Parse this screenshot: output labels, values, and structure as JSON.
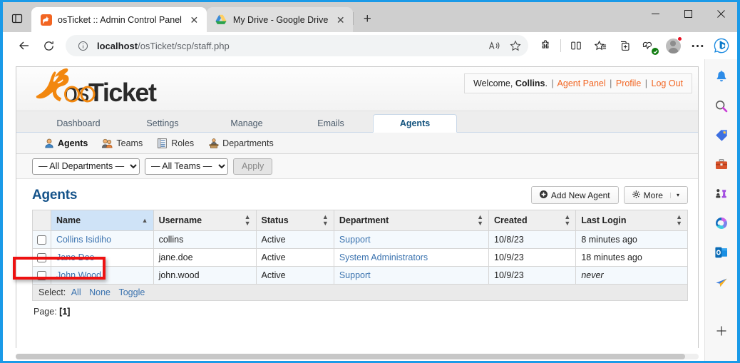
{
  "browser": {
    "tab_search_icon": "tab-search-icon",
    "tabs": [
      {
        "title": "osTicket :: Admin Control Panel",
        "favicon": "osticket-favicon",
        "close": "✕",
        "active": true
      },
      {
        "title": "My Drive - Google Drive",
        "favicon": "google-drive-favicon",
        "close": "✕",
        "active": false
      }
    ],
    "new_tab_label": "+",
    "window_controls": {
      "minimize": "—",
      "maximize": "☐",
      "close": "✕"
    },
    "toolbar": {
      "back_icon": "back-arrow-icon",
      "refresh_icon": "refresh-icon",
      "info_icon": "site-info-icon",
      "url_prefix": "localhost",
      "url_suffix": "/osTicket/scp/staff.php",
      "read_aloud_icon": "read-aloud-icon",
      "favorite_icon": "favorite-star-icon",
      "extensions_icon": "extensions-puzzle-icon",
      "split_screen_icon": "split-screen-icon",
      "collections_icon": "collections-icon",
      "browser_essentials_icon": "add-tab-to-collection-icon",
      "performance_icon": "browser-essentials-icon",
      "profile_icon": "profile-avatar-icon",
      "settings_icon": "settings-more-icon",
      "copilot_icon": "bing-copilot-icon"
    },
    "sidebar_icons": [
      "notifications-bell-icon",
      "search-icon",
      "shopping-tag-icon",
      "tools-briefcase-icon",
      "games-chess-icon",
      "microsoft-365-icon",
      "outlook-icon",
      "send-plane-icon",
      "add-sidebar-icon"
    ]
  },
  "osticket": {
    "logo_text": "osTicket",
    "welcome": {
      "prefix": "Welcome,",
      "user": "Collins",
      "period": ".",
      "links": [
        "Agent Panel",
        "Profile",
        "Log Out"
      ]
    },
    "main_tabs": [
      {
        "label": "Dashboard",
        "active": false
      },
      {
        "label": "Settings",
        "active": false
      },
      {
        "label": "Manage",
        "active": false
      },
      {
        "label": "Emails",
        "active": false
      },
      {
        "label": "Agents",
        "active": true
      }
    ],
    "sub_nav": [
      {
        "label": "Agents",
        "icon": "agent-person-icon",
        "active": true
      },
      {
        "label": "Teams",
        "icon": "teams-people-icon",
        "active": false
      },
      {
        "label": "Roles",
        "icon": "roles-list-icon",
        "active": false
      },
      {
        "label": "Departments",
        "icon": "departments-desk-icon",
        "active": false
      }
    ],
    "filters": {
      "department_value": "— All Departments —",
      "department_options": [
        "— All Departments —"
      ],
      "team_value": "— All Teams —",
      "team_options": [
        "— All Teams —"
      ],
      "apply_label": "Apply"
    },
    "page_title": "Agents",
    "buttons": {
      "add_new_agent": "Add New Agent",
      "add_icon": "plus-circle-icon",
      "more": "More",
      "more_icon": "gear-icon",
      "more_caret": "▾"
    },
    "table": {
      "columns": [
        {
          "label": "Name",
          "sorted": true,
          "sort_dir": "asc"
        },
        {
          "label": "Username",
          "sorted": false
        },
        {
          "label": "Status",
          "sorted": false
        },
        {
          "label": "Department",
          "sorted": false
        },
        {
          "label": "Created",
          "sorted": false
        },
        {
          "label": "Last Login",
          "sorted": false
        }
      ],
      "rows": [
        {
          "name": "Collins Isidiho",
          "username": "collins",
          "status": "Active",
          "department": "Support",
          "created": "10/8/23",
          "last_login": "8 minutes ago",
          "never": false,
          "highlighted": false
        },
        {
          "name": "Jane Doe",
          "username": "jane.doe",
          "status": "Active",
          "department": "System Administrators",
          "created": "10/9/23",
          "last_login": "18 minutes ago",
          "never": false,
          "highlighted": true
        },
        {
          "name": "John Wood",
          "username": "john.wood",
          "status": "Active",
          "department": "Support",
          "created": "10/9/23",
          "last_login": "never",
          "never": true,
          "highlighted": false
        }
      ]
    },
    "select_bar": {
      "label": "Select:",
      "all": "All",
      "none": "None",
      "toggle": "Toggle"
    },
    "pager": {
      "label": "Page:",
      "current": "[1]"
    }
  },
  "colors": {
    "accent_orange": "#f26522",
    "link_blue": "#3b73af",
    "title_blue": "#15538a",
    "highlight_red": "#ee1111",
    "window_border": "#1a9ae8"
  }
}
